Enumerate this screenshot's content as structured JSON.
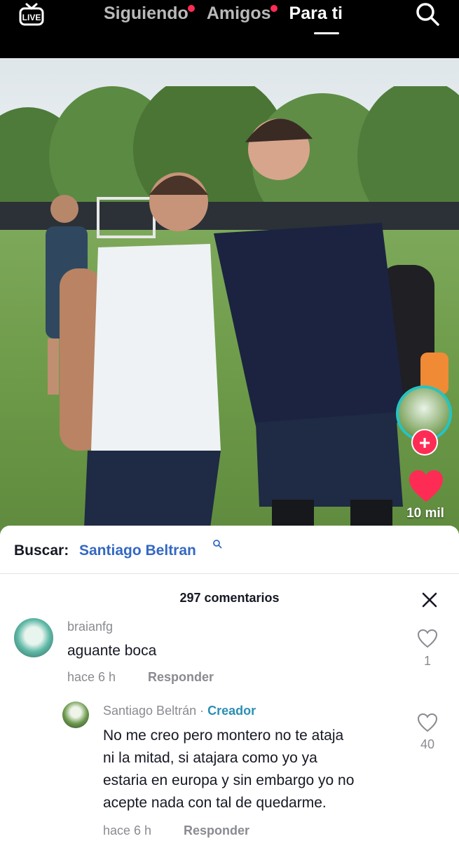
{
  "header": {
    "live_icon": "live-tv-icon",
    "tabs": [
      {
        "label": "Siguiendo",
        "dot": true
      },
      {
        "label": "Amigos",
        "dot": true
      },
      {
        "label": "Para ti",
        "active": true
      }
    ],
    "search_icon": "search-icon"
  },
  "video": {
    "likes": "10 mil",
    "follow_symbol": "+"
  },
  "search_bar": {
    "label": "Buscar:",
    "term": "Santiago Beltran"
  },
  "comments": {
    "count_label": "297 comentarios",
    "items": [
      {
        "user": "braianfg",
        "text": "aguante boca",
        "time": "hace 6 h",
        "reply": "Responder",
        "likes": "1"
      },
      {
        "user": "Santiago Beltrán",
        "separator": " · ",
        "tag": "Creador",
        "text_lines": [
          "No me creo pero montero no te ataja",
          "ni la mitad, si atajara como yo ya",
          "estaria en europa y sin embargo yo no",
          "acepte nada con tal de quedarme."
        ],
        "time": "hace 6 h",
        "reply": "Responder",
        "likes": "40"
      }
    ]
  },
  "colors": {
    "accent_red": "#fe2c55",
    "creator_teal": "#2b8fb3",
    "search_blue": "#3468c2"
  }
}
